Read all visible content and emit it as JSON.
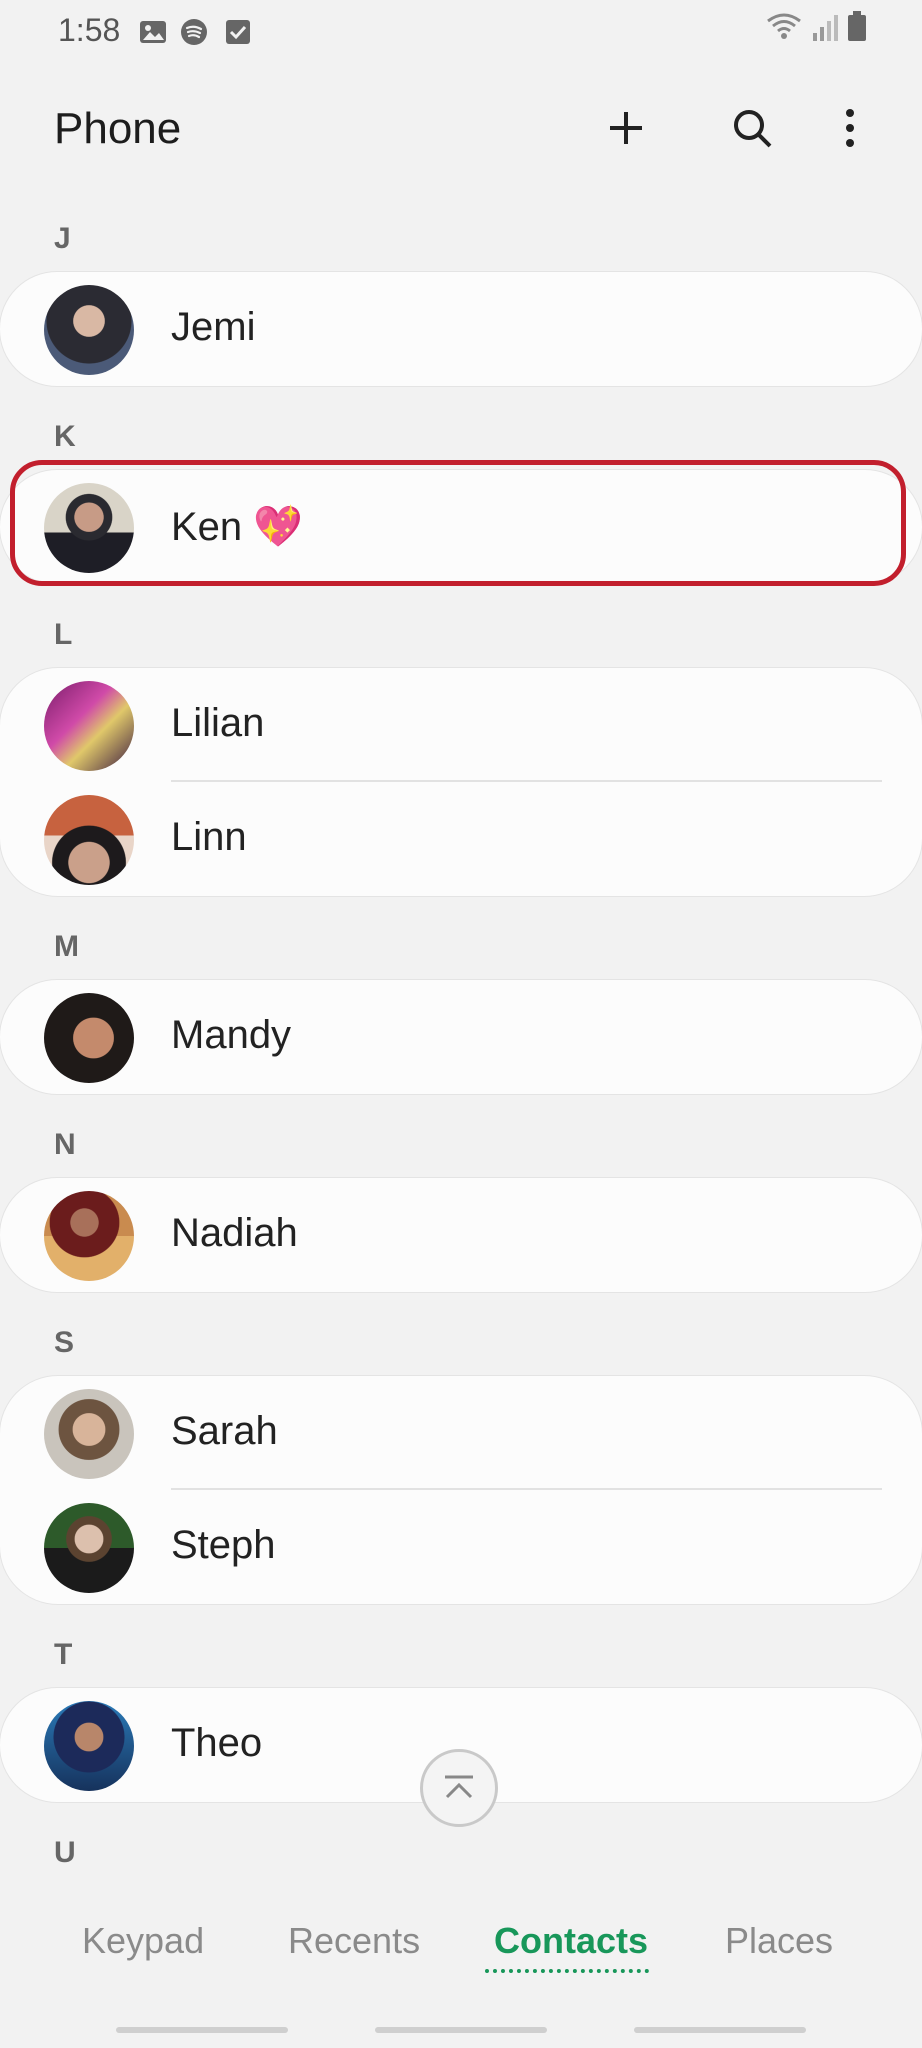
{
  "status_bar": {
    "time": "1:58",
    "left_icons": [
      "image-icon",
      "spotify-icon",
      "checkbox-icon"
    ],
    "right_icons": [
      "wifi-icon",
      "signal-icon",
      "battery-icon"
    ]
  },
  "header": {
    "title": "Phone",
    "actions": [
      "add-icon",
      "search-icon",
      "more-vert-icon"
    ]
  },
  "contacts": {
    "sections": [
      {
        "letter": "J",
        "items": [
          {
            "name": "Jemi"
          }
        ]
      },
      {
        "letter": "K",
        "items": [
          {
            "name": "Ken 💖"
          }
        ]
      },
      {
        "letter": "L",
        "items": [
          {
            "name": "Lilian"
          },
          {
            "name": "Linn"
          }
        ]
      },
      {
        "letter": "M",
        "items": [
          {
            "name": "Mandy"
          }
        ]
      },
      {
        "letter": "N",
        "items": [
          {
            "name": "Nadiah"
          }
        ]
      },
      {
        "letter": "S",
        "items": [
          {
            "name": "Sarah"
          },
          {
            "name": "Steph"
          }
        ]
      },
      {
        "letter": "T",
        "items": [
          {
            "name": "Theo"
          }
        ]
      },
      {
        "letter": "U",
        "items": []
      }
    ]
  },
  "tabs": {
    "keypad": "Keypad",
    "recents": "Recents",
    "contacts": "Contacts",
    "places": "Places",
    "active": "Contacts"
  },
  "colors": {
    "accent": "#18975a",
    "highlight": "#c21f2d",
    "background": "#f2f2f2"
  }
}
